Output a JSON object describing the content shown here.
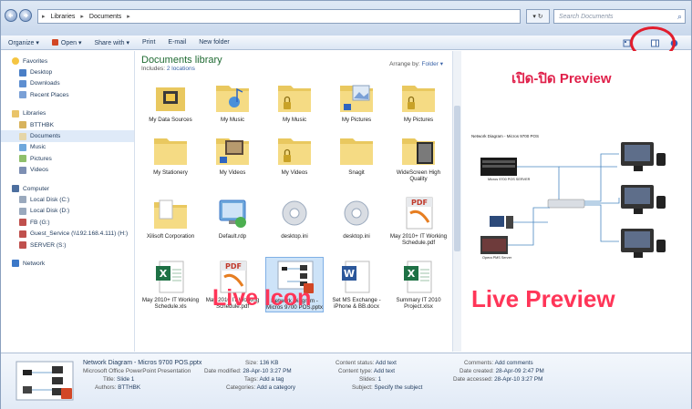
{
  "address": {
    "breadcrumb": [
      "Libraries",
      "Documents"
    ],
    "search_placeholder": "Search Documents"
  },
  "toolbar": {
    "organize": "Organize ▾",
    "open": "Open ▾",
    "share": "Share with ▾",
    "print": "Print",
    "email": "E-mail",
    "new_folder": "New folder"
  },
  "nav": {
    "favorites": "Favorites",
    "favorites_items": [
      "Desktop",
      "Downloads",
      "Recent Places"
    ],
    "libraries": "Libraries",
    "libraries_items": [
      "BTTHBK",
      "Documents",
      "Music",
      "Pictures",
      "Videos"
    ],
    "computer": "Computer",
    "computer_items": [
      "Local Disk (C:)",
      "Local Disk (D:)",
      "FB (G:)",
      "Guest_Service (\\\\192.168.4.111) (H:)",
      "SERVER (S:)"
    ],
    "network": "Network"
  },
  "library": {
    "title": "Documents library",
    "includes": "Includes: ",
    "locations": "2 locations",
    "arrange_label": "Arrange by: ",
    "arrange_value": "Folder ▾"
  },
  "files": [
    {
      "name": "My Data Sources"
    },
    {
      "name": "My Music"
    },
    {
      "name": "My Music"
    },
    {
      "name": "My Pictures"
    },
    {
      "name": "My Pictures"
    },
    {
      "name": "My Stationery"
    },
    {
      "name": "My Videos"
    },
    {
      "name": "My Videos"
    },
    {
      "name": "Snagit"
    },
    {
      "name": "WideScreen High Quality"
    },
    {
      "name": "Xilisoft Corporation"
    },
    {
      "name": "Default.rdp"
    },
    {
      "name": "desktop.ini"
    },
    {
      "name": "desktop.ini"
    },
    {
      "name": "May 2010+ IT Working Schedule.pdf"
    },
    {
      "name": "May 2010+ IT Working Schedule.xls"
    },
    {
      "name": "May 2010 IT Working Schedule.pdf"
    },
    {
      "name": "Network Diagram - Micros 9700 POS.pptx"
    },
    {
      "name": "Set MS Exchange - iPhone & BB.docx"
    },
    {
      "name": "Summary IT 2010 Project.xlsx"
    }
  ],
  "overlay": {
    "preview_toggle": "เปิด-ปิด Preview",
    "live_icon": "Live Icon",
    "live_preview": "Live Preview"
  },
  "preview": {
    "slide_title": "Network Diagram - Micros 9700 POS",
    "labels": [
      "Micros 9700 POS SERVER",
      "Opera PMS Server"
    ]
  },
  "details": {
    "title": "Network Diagram - Micros 9700 POS.pptx",
    "type": "Microsoft Office PowerPoint Presentation",
    "col1": [
      [
        "Title:",
        "Slide 1"
      ],
      [
        "Authors:",
        "BTTHBK"
      ]
    ],
    "col2": [
      [
        "Size:",
        "136 KB"
      ],
      [
        "Date modified:",
        "28-Apr-10 3:27 PM"
      ],
      [
        "Tags:",
        "Add a tag"
      ],
      [
        "Categories:",
        "Add a category"
      ]
    ],
    "col3": [
      [
        "Content status:",
        "Add text"
      ],
      [
        "Content type:",
        "Add text"
      ],
      [
        "Slides:",
        "1"
      ],
      [
        "Subject:",
        "Specify the subject"
      ]
    ],
    "col4": [
      [
        "Comments:",
        "Add comments"
      ],
      [
        "Date created:",
        "28-Apr-09 2:47 PM"
      ],
      [
        "Date accessed:",
        "28-Apr-10 3:27 PM"
      ]
    ]
  },
  "colors": {
    "annotation_red": "#e21d2d",
    "library_green": "#1f6a32",
    "link_blue": "#3a63a8"
  }
}
